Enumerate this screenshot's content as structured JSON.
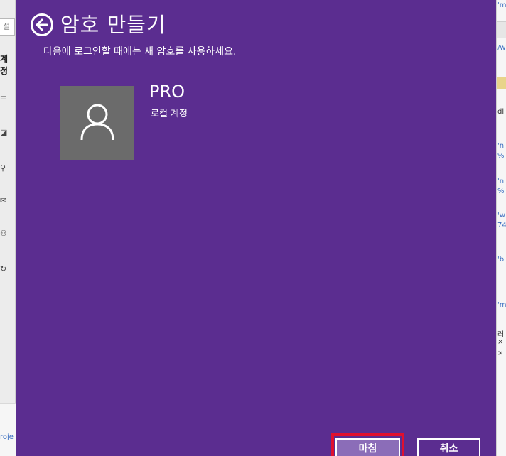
{
  "background_left": {
    "search_text": "설",
    "section_label": "계정",
    "project_link": "roje"
  },
  "background_right": {
    "fragments": [
      "'m",
      "/w",
      "dl",
      "'n",
      "%",
      "'n",
      "%",
      "'w",
      "74",
      "'b",
      "'m",
      "러",
      "×",
      "×"
    ]
  },
  "dialog": {
    "title": "암호 만들기",
    "subtitle": "다음에 로그인할 때에는 새 암호를 사용하세요.",
    "account": {
      "name": "PRO",
      "type": "로컬 계정"
    },
    "buttons": {
      "finish_label": "마침",
      "cancel_label": "취소"
    },
    "colors": {
      "dialog_bg": "#5b2d90",
      "avatar_bg": "#6b6b6b",
      "finish_bg": "#8b6db8",
      "highlight": "#e0102f"
    }
  }
}
